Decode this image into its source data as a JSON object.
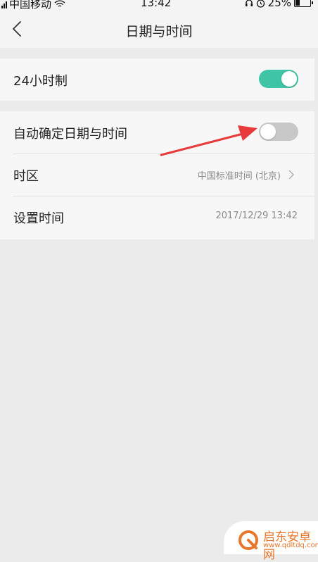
{
  "status_bar": {
    "carrier": "中国移动",
    "time": "13:42",
    "battery": "25%"
  },
  "nav": {
    "title": "日期与时间"
  },
  "settings": {
    "hour24": {
      "label": "24小时制",
      "enabled": true
    },
    "auto_datetime": {
      "label": "自动确定日期与时间",
      "enabled": false
    },
    "timezone": {
      "label": "时区",
      "value": "中国标准时间 (北京)"
    },
    "set_time": {
      "label": "设置时间",
      "value": "2017/12/29  13:42"
    }
  },
  "colors": {
    "toggle_on": "#40c4a6",
    "toggle_off": "#c8c8c8",
    "annotation_arrow": "#e83a3a",
    "watermark": "#e8762b"
  },
  "watermark": {
    "name": "启东安卓网",
    "url": "www.qdltdq.com"
  }
}
